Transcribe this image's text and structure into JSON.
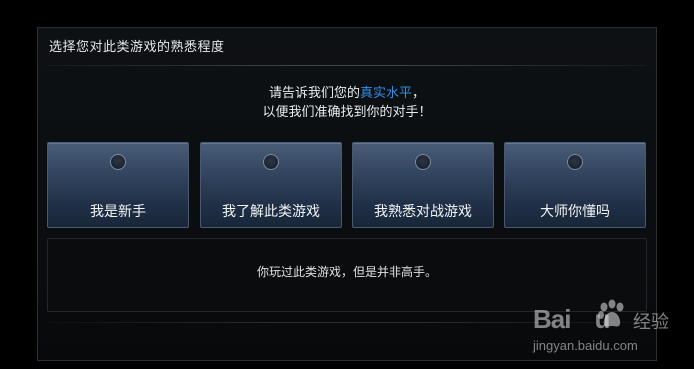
{
  "dialog": {
    "title": "选择您对此类游戏的熟悉程度"
  },
  "prompt": {
    "line1_prefix": "请告诉我们您的",
    "line1_highlight": "真实水平",
    "line1_suffix": "，",
    "line2": "以便我们准确找到你的对手！",
    "highlight_color": "#2e8fe6"
  },
  "options": [
    {
      "label": "我是新手"
    },
    {
      "label": "我了解此类游戏"
    },
    {
      "label": "我熟悉对战游戏"
    },
    {
      "label": "大师你懂吗"
    }
  ],
  "description": {
    "text": "你玩过此类游戏，但是并非高手。"
  },
  "watermark": {
    "brand": "Bai",
    "brand_suffix": "u",
    "product": "经验",
    "url": "jingyan.baidu.com"
  }
}
